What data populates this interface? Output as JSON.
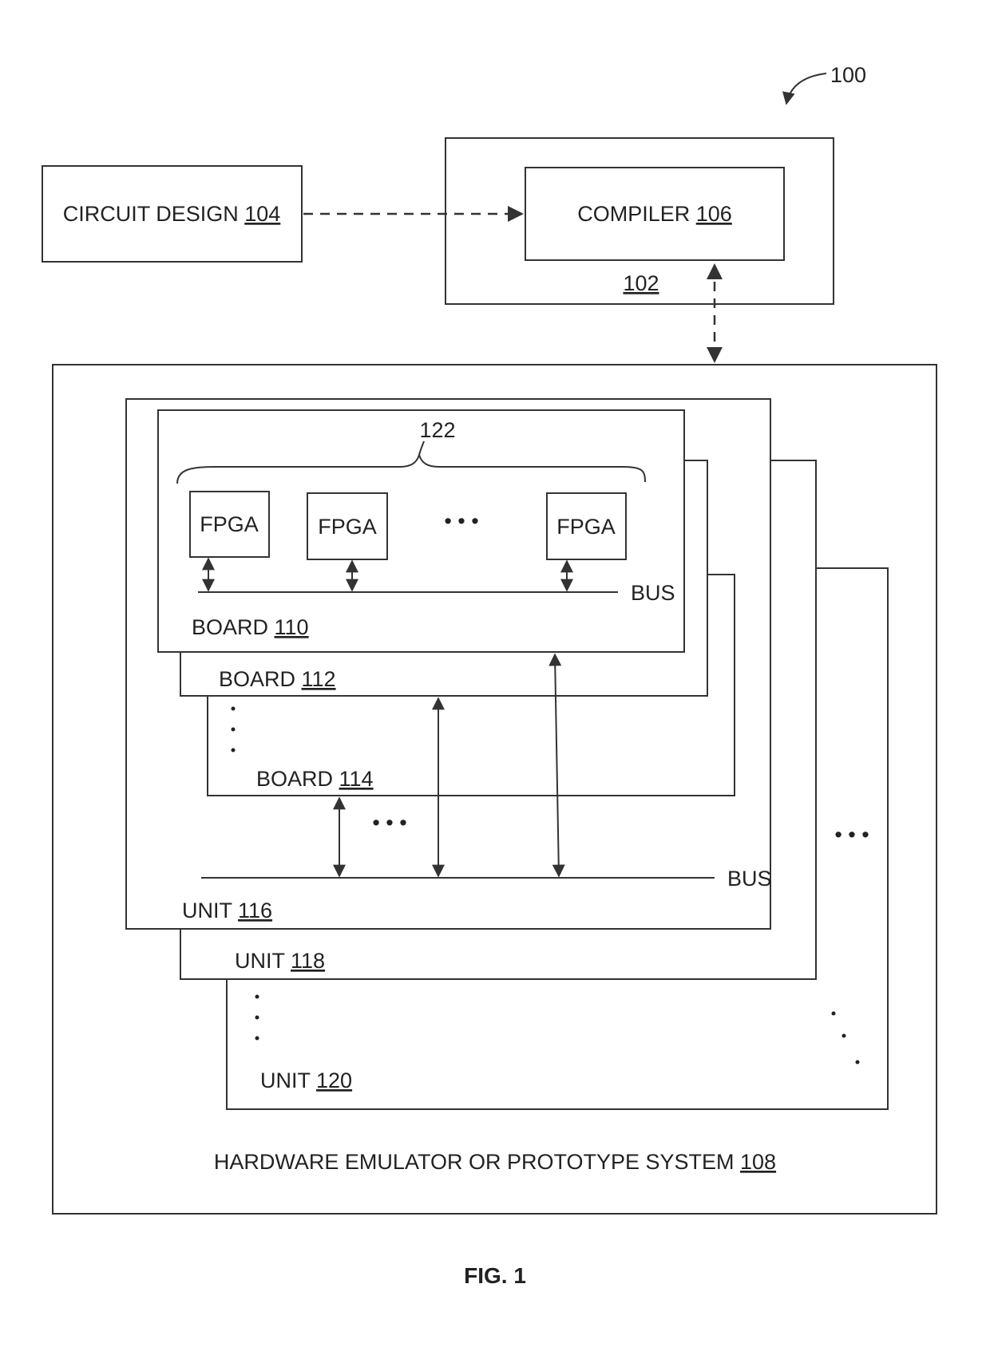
{
  "figure": {
    "reference": "100",
    "caption": "FIG. 1"
  },
  "blocks": {
    "circuit_design": {
      "text": "CIRCUIT DESIGN ",
      "ref": "104"
    },
    "host": {
      "ref": "102"
    },
    "compiler": {
      "text": "COMPILER ",
      "ref": "106"
    },
    "system": {
      "text": "HARDWARE EMULATOR OR PROTOTYPE SYSTEM ",
      "ref": "108"
    },
    "board_110": {
      "text": "BOARD ",
      "ref": "110"
    },
    "board_112": {
      "text": "BOARD ",
      "ref": "112"
    },
    "board_114": {
      "text": "BOARD ",
      "ref": "114"
    },
    "unit_116": {
      "text": "UNIT ",
      "ref": "116"
    },
    "unit_118": {
      "text": "UNIT ",
      "ref": "118"
    },
    "unit_120": {
      "text": "UNIT ",
      "ref": "120"
    },
    "fpga_group": {
      "ref": "122"
    },
    "fpgas": [
      {
        "label": "FPGA"
      },
      {
        "label": "FPGA"
      },
      {
        "label": "FPGA"
      }
    ],
    "board_bus": {
      "label": "BUS"
    },
    "unit_bus": {
      "label": "BUS"
    },
    "ellipsis": "• • •"
  }
}
